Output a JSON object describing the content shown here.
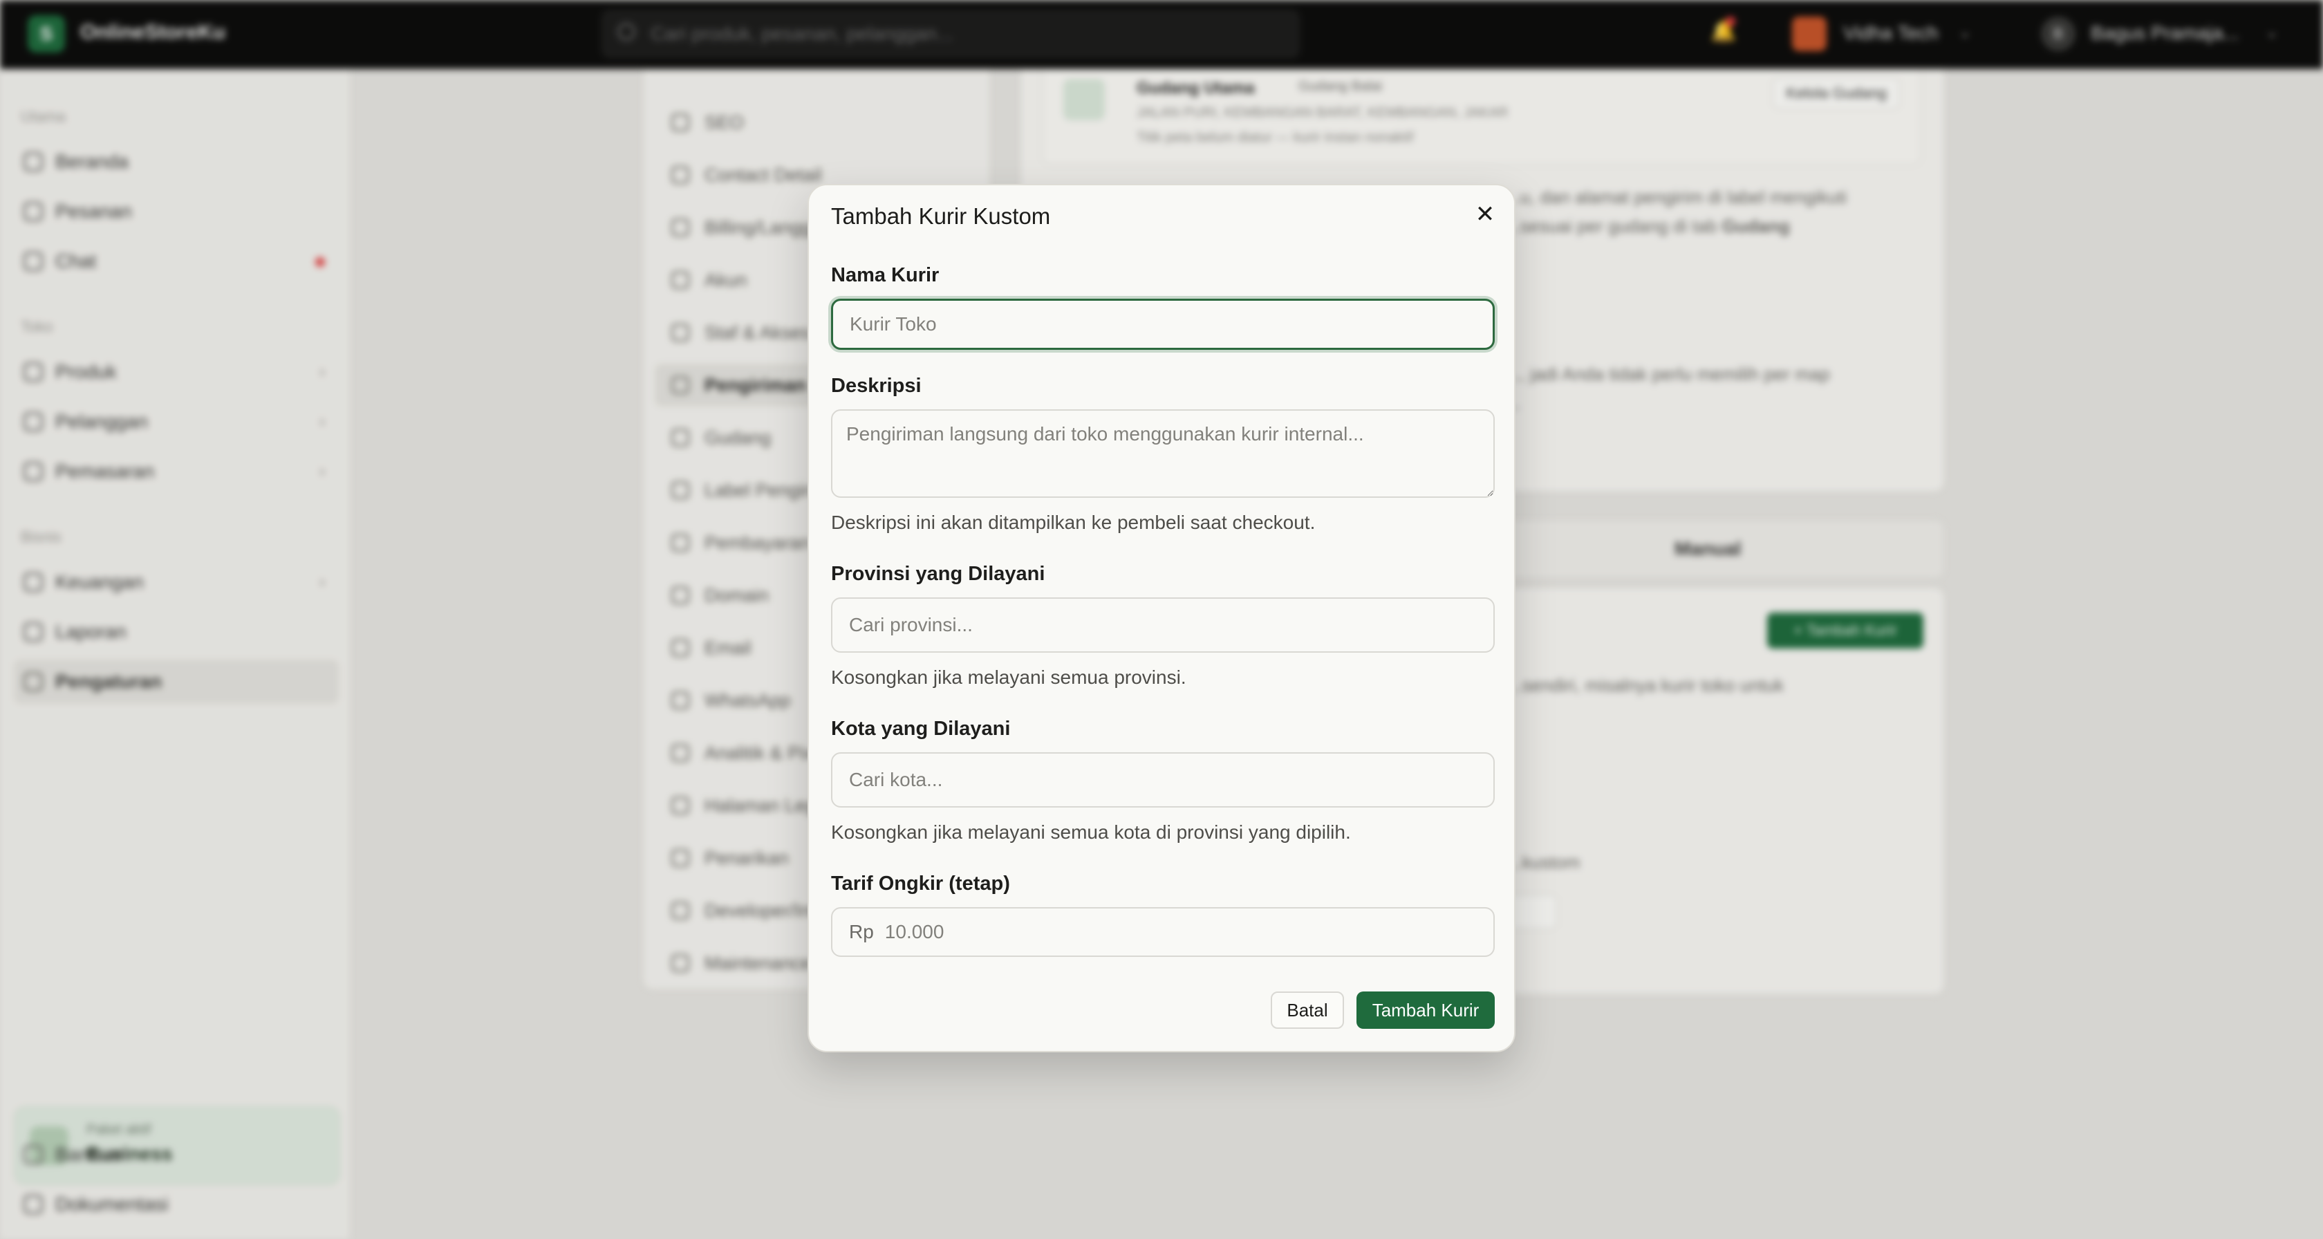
{
  "topbar": {
    "brand": "OnlineStoreKu",
    "logo_letter": "S",
    "search_placeholder": "Cari produk, pesanan, pelanggan...",
    "store_name": "Vidha Tech",
    "user_initial": "B",
    "user_name": "Bagus Pramaja..."
  },
  "sidebar": {
    "sections": [
      {
        "title": "Utama",
        "items": [
          {
            "label": "Beranda",
            "icon": "home-icon"
          },
          {
            "label": "Pesanan",
            "icon": "orders-icon"
          },
          {
            "label": "Chat",
            "icon": "chat-icon"
          }
        ]
      },
      {
        "title": "Toko",
        "items": [
          {
            "label": "Produk",
            "icon": "box-icon"
          },
          {
            "label": "Pelanggan",
            "icon": "users-icon"
          },
          {
            "label": "Pemasaran",
            "icon": "megaphone-icon"
          }
        ]
      },
      {
        "title": "Bisnis",
        "items": [
          {
            "label": "Keuangan",
            "icon": "wallet-icon"
          },
          {
            "label": "Laporan",
            "icon": "report-icon"
          },
          {
            "label": "Pengaturan",
            "icon": "gear-icon"
          }
        ]
      }
    ],
    "plan_label": "Paket aktif",
    "plan_name": "Business",
    "footer": [
      "Bantuan",
      "Dokumentasi"
    ]
  },
  "settings_nav": [
    "SEO",
    "Contact Detail",
    "Billing/Langganan",
    "Akun",
    "Staf & Akses",
    "Pengiriman",
    "Gudang",
    "Label Pengiriman",
    "Pembayaran",
    "Domain",
    "Email",
    "WhatsApp",
    "Analitik & Pixel",
    "Halaman Legal",
    "Penarikan",
    "Developer/Integrasi",
    "Maintenance"
  ],
  "background": {
    "warehouse_name": "Gudang Utama",
    "warehouse_tag": "Gudang Balai",
    "warehouse_line1": "JALAN PURI, KEMBANGAN BARAT, KEMBANGAN, JAKAR",
    "warehouse_line2": "Titik peta belum diatur — kurir instan nonaktif",
    "warehouse_button": "Kelola Gudang",
    "text1_a": "...u, dan alamat pengirim di label mengikuti",
    "text1_b": "...sesuai per gudang di tab",
    "text1_bold": "Gudang",
    "text2_a": "..., jadi Anda tidak perlu memilih per map",
    "text2_b": "...",
    "tab_manual": "Manual",
    "add_courier": "+ Tambah Kurir",
    "text3": "...sendiri, misalnya kurir toko untuk",
    "text4": "...kustom"
  },
  "modal": {
    "title": "Tambah Kurir Kustom",
    "name_label": "Nama Kurir",
    "name_placeholder": "Kurir Toko",
    "desc_label": "Deskripsi",
    "desc_placeholder": "Pengiriman langsung dari toko menggunakan kurir internal...",
    "desc_help": "Deskripsi ini akan ditampilkan ke pembeli saat checkout.",
    "province_label": "Provinsi yang Dilayani",
    "province_placeholder": "Cari provinsi...",
    "province_help": "Kosongkan jika melayani semua provinsi.",
    "city_label": "Kota yang Dilayani",
    "city_placeholder": "Cari kota...",
    "city_help": "Kosongkan jika melayani semua kota di provinsi yang dipilih.",
    "rate_label": "Tarif Ongkir (tetap)",
    "rate_prefix": "Rp",
    "rate_placeholder": "10.000",
    "cancel_label": "Batal",
    "submit_label": "Tambah Kurir",
    "close_glyph": "✕"
  },
  "colors": {
    "accent": "#1f6b3d",
    "focus_ring": "#2d6a3f",
    "badge": "#e04848"
  }
}
